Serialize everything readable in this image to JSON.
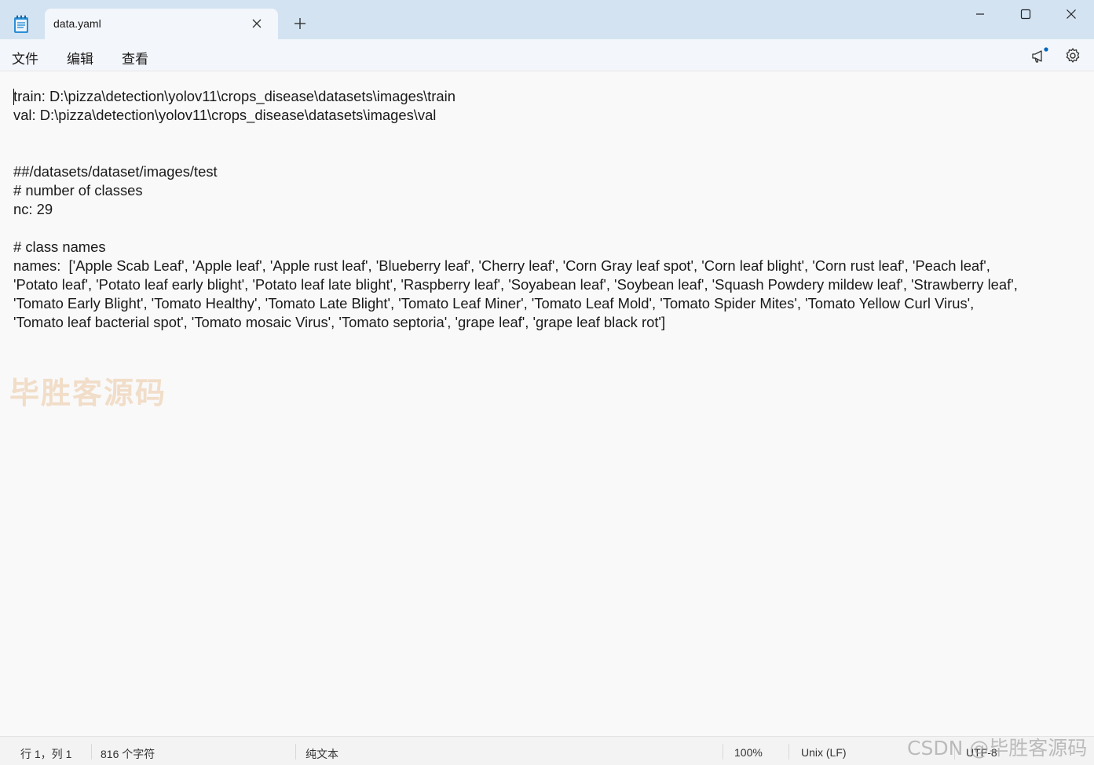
{
  "window": {
    "tab_title": "data.yaml",
    "icons": [
      "notepad-icon",
      "close-icon",
      "plus-icon",
      "minimize-icon",
      "maximize-icon",
      "close-icon",
      "megaphone-icon",
      "gear-icon"
    ]
  },
  "menu": {
    "file": "文件",
    "edit": "编辑",
    "view": "查看"
  },
  "editor": {
    "content": "train: D:\\pizza\\detection\\yolov11\\crops_disease\\datasets\\images\\train\nval: D:\\pizza\\detection\\yolov11\\crops_disease\\datasets\\images\\val\n\n\n##/datasets/dataset/images/test\n# number of classes\nnc: 29\n\n# class names\nnames:  ['Apple Scab Leaf', 'Apple leaf', 'Apple rust leaf', 'Blueberry leaf', 'Cherry leaf', 'Corn Gray leaf spot', 'Corn leaf blight', 'Corn rust leaf', 'Peach leaf',\n'Potato leaf', 'Potato leaf early blight', 'Potato leaf late blight', 'Raspberry leaf', 'Soyabean leaf', 'Soybean leaf', 'Squash Powdery mildew leaf', 'Strawberry leaf',\n'Tomato Early Blight', 'Tomato Healthy', 'Tomato Late Blight', 'Tomato Leaf Miner', 'Tomato Leaf Mold', 'Tomato Spider Mites', 'Tomato Yellow Curl Virus',\n'Tomato leaf bacterial spot', 'Tomato mosaic Virus', 'Tomato septoria', 'grape leaf', 'grape leaf black rot']"
  },
  "status": {
    "position": "行 1，列 1",
    "char_count": "816 个字符",
    "file_type": "纯文本",
    "zoom": "100%",
    "line_ending": "Unix (LF)",
    "encoding": "UTF-8"
  },
  "watermarks": {
    "editor": "毕胜客源码",
    "corner": "CSDN @毕胜客源码"
  },
  "colors": {
    "titlebar": "#d3e3f2",
    "tab": "#f3f6fa",
    "editor_bg": "#f9f9f9",
    "notification_dot": "#0067c0"
  }
}
